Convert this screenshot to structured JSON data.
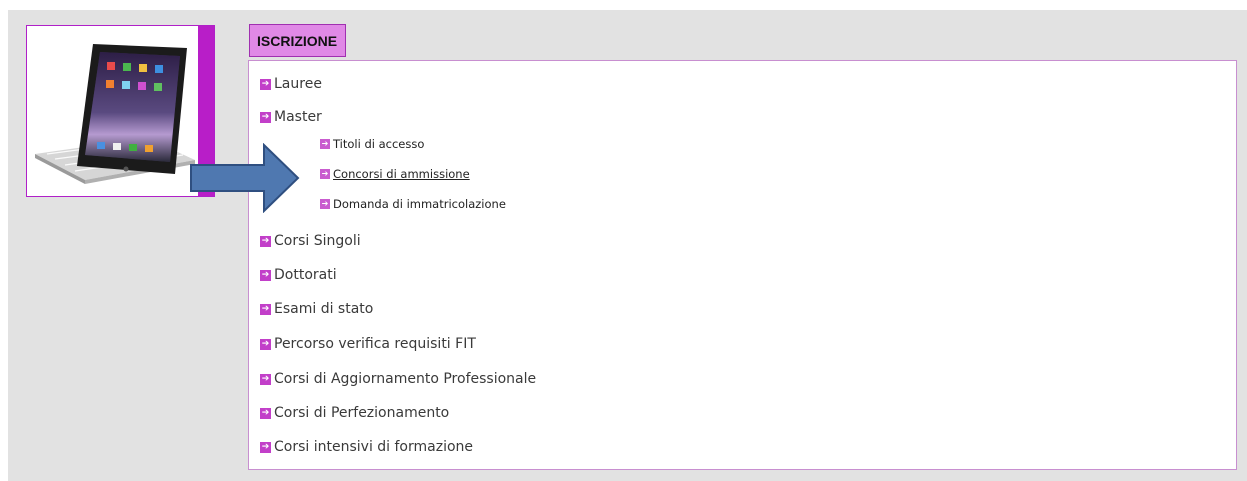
{
  "section": {
    "title": "ISCRIZIONE"
  },
  "menu": {
    "items": [
      {
        "label": "Lauree"
      },
      {
        "label": "Master"
      },
      {
        "label": "Corsi Singoli"
      },
      {
        "label": "Dottorati"
      },
      {
        "label": "Esami di stato"
      },
      {
        "label": "Percorso verifica requisiti FIT"
      },
      {
        "label": "Corsi di Aggiornamento Professionale"
      },
      {
        "label": "Corsi di Perfezionamento"
      },
      {
        "label": "Corsi intensivi di formazione"
      }
    ],
    "master_sub": [
      {
        "label": "Titoli di accesso"
      },
      {
        "label": "Concorsi di ammissione"
      },
      {
        "label": "Domanda di immatricolazione"
      }
    ]
  },
  "icons": {
    "bullet": "arrow-right-icon",
    "callout": "big-arrow-right-icon"
  },
  "colors": {
    "accent": "#b81ec8",
    "header_bg": "#e089e6",
    "arrow_fill": "#4f78b0"
  }
}
